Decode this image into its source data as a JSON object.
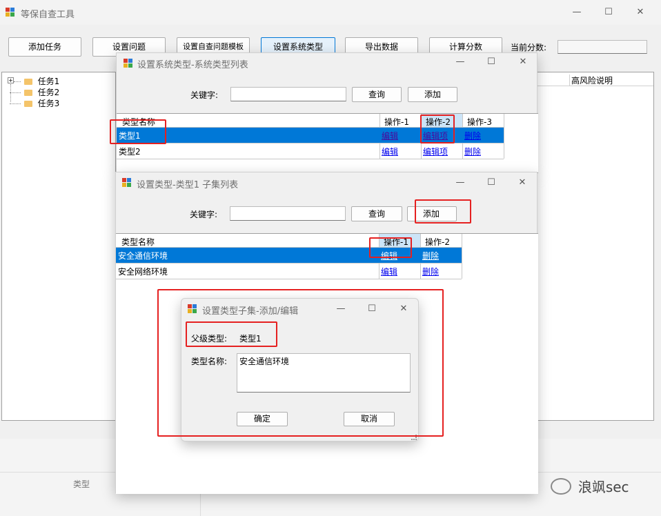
{
  "main": {
    "title": "等保自查工具",
    "toolbar": {
      "add_task": "添加任务",
      "set_question": "设置问题",
      "set_template": "设置自查问题模板",
      "set_system_type": "设置系统类型",
      "export_data": "导出数据",
      "calc_score": "计算分数",
      "score_label": "当前分数:",
      "score_value": ""
    },
    "tree": [
      "任务1",
      "任务2",
      "任务3"
    ],
    "right_header": "高风险说明",
    "bottom_label": "类型"
  },
  "sys_type_window": {
    "title": "设置系统类型-系统类型列表",
    "keyword_label": "关键字:",
    "keyword_value": "",
    "query": "查询",
    "add": "添加",
    "columns": [
      "类型名称",
      "操作-1",
      "操作-2",
      "操作-3"
    ],
    "rows": [
      {
        "name": "类型1",
        "op1": "编辑",
        "op2": "编辑项",
        "op3": "删除"
      },
      {
        "name": "类型2",
        "op1": "编辑",
        "op2": "编辑项",
        "op3": "删除"
      }
    ]
  },
  "subset_window": {
    "title": "设置类型-类型1 子集列表",
    "keyword_label": "关键字:",
    "keyword_value": "",
    "query": "查询",
    "add": "添加",
    "columns": [
      "类型名称",
      "操作-1",
      "操作-2"
    ],
    "rows": [
      {
        "name": "安全通信环境",
        "op1": "编辑",
        "op2": "删除"
      },
      {
        "name": "安全网络环境",
        "op1": "编辑",
        "op2": "删除"
      }
    ]
  },
  "edit_dialog": {
    "title": "设置类型子集-添加/编辑",
    "parent_label": "父级类型:",
    "parent_value": "类型1",
    "name_label": "类型名称:",
    "name_value": "安全通信环境",
    "ok": "确定",
    "cancel": "取消"
  },
  "watermark": "浪飒sec",
  "colors": {
    "selection": "#0078d7",
    "highlight_box": "#e52020",
    "link": "#0000ee"
  }
}
